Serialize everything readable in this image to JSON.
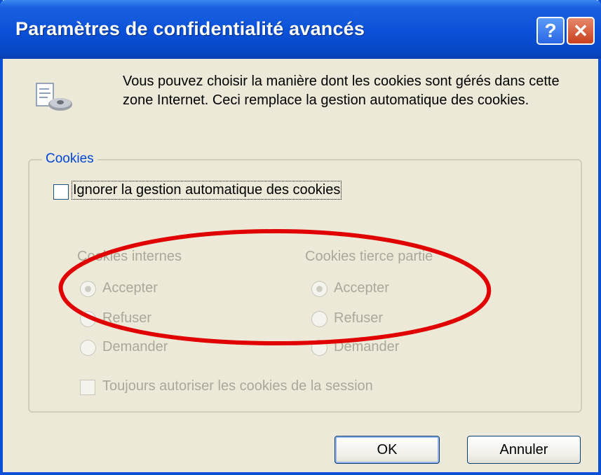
{
  "window": {
    "title": "Paramètres de confidentialité avancés",
    "help_label": "?",
    "close_label": "✕"
  },
  "intro": {
    "text": "Vous pouvez choisir la manière dont les cookies sont gérés dans cette zone Internet. Ceci remplace la gestion automatique des cookies."
  },
  "cookies_group": {
    "legend": "Cookies",
    "override_checkbox": {
      "label": "Ignorer la gestion automatique des cookies",
      "checked": false
    },
    "first_party": {
      "heading": "Cookies internes",
      "options": [
        "Accepter",
        "Refuser",
        "Demander"
      ],
      "selected": "Accepter"
    },
    "third_party": {
      "heading": "Cookies tierce partie",
      "options": [
        "Accepter",
        "Refuser",
        "Demander"
      ],
      "selected": "Accepter"
    },
    "session_checkbox": {
      "label": "Toujours autoriser les cookies de la session",
      "checked": false
    }
  },
  "buttons": {
    "ok": "OK",
    "cancel": "Annuler"
  },
  "colors": {
    "titlebar": "#0a50d8",
    "dialog_bg": "#ece9d8",
    "legend_text": "#0046d5",
    "disabled_text": "#aca899",
    "annotation_ellipse": "#e00000"
  }
}
